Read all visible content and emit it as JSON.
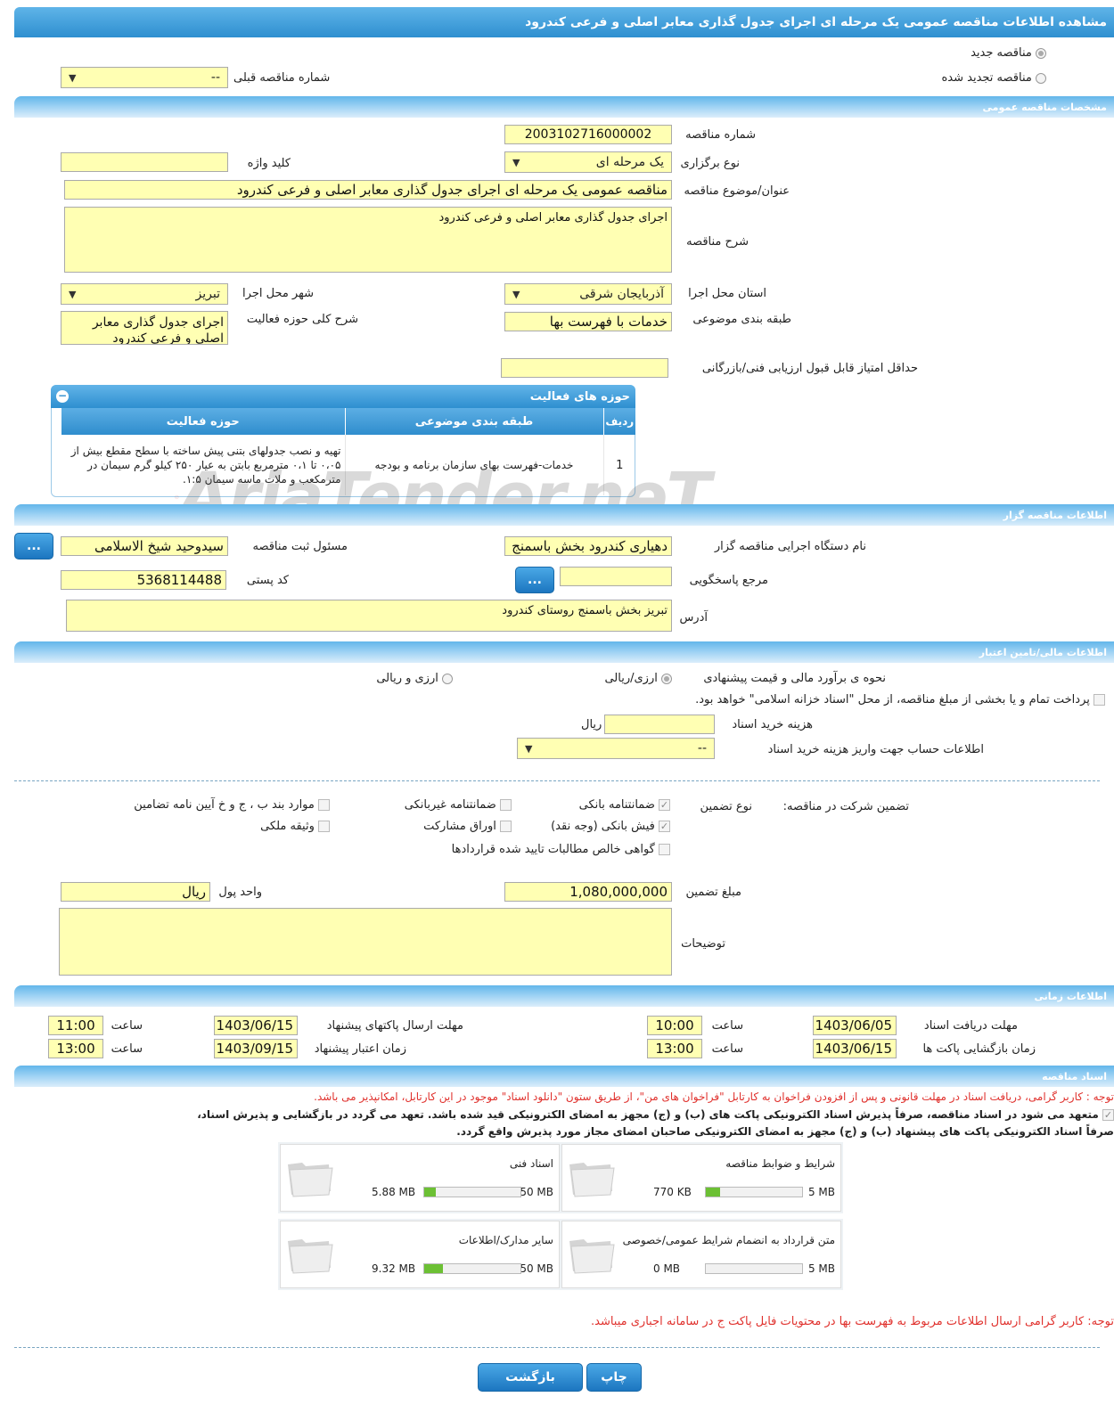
{
  "page_title": "مشاهده اطلاعات مناقصه عمومی یک مرحله ای اجرای جدول گذاری معابر اصلی و فرعی کندرود",
  "tender_type": {
    "new_label": "مناقصه جدید",
    "renewed_label": "مناقصه تجدید شده",
    "previous_number_label": "شماره مناقصه قبلی",
    "previous_number_value": "--"
  },
  "general": {
    "section_title": "مشخصات مناقصه عمومی",
    "number_label": "شماره مناقصه",
    "number_value": "2003102716000002",
    "holding_type_label": "نوع برگزاری",
    "holding_type_value": "یک مرحله ای",
    "keyword_label": "کلید واژه",
    "keyword_value": "",
    "subject_label": "عنوان/موضوع مناقصه",
    "subject_value": "مناقصه عمومی یک مرحله ای اجرای جدول گذاری معابر اصلی و فرعی کندرود",
    "description_label": "شرح مناقصه",
    "description_value": "اجرای جدول گذاری معابر اصلی و فرعی کندرود",
    "province_label": "استان محل اجرا",
    "province_value": "آذربایجان شرقی",
    "city_label": "شهر محل اجرا",
    "city_value": "تبریز",
    "category_label": "طبقه بندی موضوعی",
    "category_value": "خدمات با فهرست بها",
    "activity_desc_label": "شرح کلی حوزه فعالیت",
    "activity_desc_value": "اجرای جدول گذاری معابر اصلی و فرعی کندرود",
    "min_score_label": "حداقل امتیاز قابل قبول ارزیابی فنی/بازرگانی",
    "min_score_value": ""
  },
  "activities": {
    "title": "حوزه های فعالیت",
    "headers": [
      "ردیف",
      "طبقه بندی موضوعی",
      "حوزه فعالیت"
    ],
    "rows": [
      [
        "1",
        "خدمات-فهرست بهای سازمان برنامه و بودجه",
        "تهیه و نصب جدولهای بتنی پیش ساخته با سطح مقطع بیش از ۰،۰۵ تا ۰،۱ مترمربع بابتن به عیار ۲۵۰ کیلو گرم سیمان در مترمکعب و ملات ماسه سیمان ۱:۵."
      ]
    ]
  },
  "watermark": "AriaTender.neT",
  "organizer": {
    "section_title": "اطلاعات مناقصه گزار",
    "agency_label": "نام دستگاه اجرایی مناقصه گزار",
    "agency_value": "دهیاری کندرود بخش باسمنج",
    "responsible_label": "مسئول ثبت مناقصه",
    "responsible_value": "سیدوحید شیخ الاسلامی",
    "reference_label": "مرجع پاسخگویی",
    "reference_value": "",
    "postal_label": "کد پستی",
    "postal_value": "5368114488",
    "address_label": "آدرس",
    "address_value": "تبریز بخش باسمنج روستای کندرود",
    "more_button": "..."
  },
  "financial": {
    "section_title": "اطلاعات مالی/تامین اعتبار",
    "estimate_label": "نحوه ی برآورد مالی و قیمت پیشنهادی",
    "opt_rial": "ارزی/ریالی",
    "opt_currency": "ارزی و ریالی",
    "treasury_text": "پرداخت تمام و یا بخشی از مبلغ مناقصه، از محل \"اسناد خزانه اسلامی\" خواهد بود.",
    "doc_cost_label": "هزینه خرید اسناد",
    "doc_cost_value": "",
    "doc_cost_unit": "ریال",
    "account_label": "اطلاعات حساب جهت واریز هزینه خرید اسناد",
    "account_value": "--"
  },
  "guarantee": {
    "label": "تضمین شرکت در مناقصه:",
    "type_label": "نوع تضمین",
    "options": [
      {
        "label": "ضمانتنامه بانکی",
        "checked": true
      },
      {
        "label": "ضمانتنامه غیربانکی",
        "checked": false
      },
      {
        "label": "موارد بند ب ، ج و خ آیین نامه تضامین",
        "checked": false
      },
      {
        "label": "فیش بانکی (وجه نقد)",
        "checked": true
      },
      {
        "label": "اوراق مشارکت",
        "checked": false
      },
      {
        "label": "وثیقه ملکی",
        "checked": false
      },
      {
        "label": "گواهی خالص مطالبات تایید شده قراردادها",
        "checked": false
      }
    ],
    "amount_label": "مبلغ تضمین",
    "amount_value": "1,080,000,000",
    "currency_label": "واحد پول",
    "currency_value": "ریال",
    "notes_label": "توضیحات",
    "notes_value": ""
  },
  "timing": {
    "section_title": "اطلاعات زمانی",
    "time_label": "ساعت",
    "receive_label": "مهلت دریافت اسناد",
    "receive_date": "1403/06/05",
    "receive_time": "10:00",
    "send_label": "مهلت ارسال پاکتهای پیشنهاد",
    "send_date": "1403/06/15",
    "send_time": "11:00",
    "open_label": "زمان بازگشایی پاکت ها",
    "open_date": "1403/06/15",
    "open_time": "13:00",
    "validity_label": "زمان اعتبار پیشنهاد",
    "validity_date": "1403/09/15",
    "validity_time": "13:00"
  },
  "documents": {
    "section_title": "اسناد مناقصه",
    "notice": "توجه : کاربر گرامی، دریافت اسناد در مهلت قانونی و پس از افزودن فراخوان به کارتابل \"فراخوان های من\"، از طریق ستون \"دانلود اسناد\" موجود در این کارتابل، امکانپذیر می باشد.",
    "commit_line1": "متعهد می شود در اسناد مناقصه، صرفاً پذیرش اسناد الکترونیکی پاکت های (ب) و (ج) مجهز به امضای الکترونیکی قید شده باشد. تعهد می گردد در بازگشایی و پذیرش اسناد،",
    "commit_line2": "صرفاً اسناد الکترونیکی پاکت های پیشنهاد (ب) و (ج) مجهز به امضای الکترونیکی صاحبان امضای مجاز مورد پذیرش واقع گردد.",
    "files": [
      {
        "name": "شرایط و ضوابط مناقصه",
        "current": "770 KB",
        "max": "5 MB",
        "fraction": 0.15
      },
      {
        "name": "اسناد فنی",
        "current": "5.88 MB",
        "max": "50 MB",
        "fraction": 0.12
      },
      {
        "name": "متن قرارداد به انضمام شرایط عمومی/خصوصی",
        "current": "0 MB",
        "max": "5 MB",
        "fraction": 0.0
      },
      {
        "name": "سایر مدارک/اطلاعات",
        "current": "9.32 MB",
        "max": "50 MB",
        "fraction": 0.19
      }
    ],
    "bottom_notice": "توجه: کاربر گرامی ارسال اطلاعات مربوط به فهرست بها در محتویات فایل پاکت ج در سامانه اجباری میباشد."
  },
  "actions": {
    "print": "چاپ",
    "back": "بازگشت"
  }
}
